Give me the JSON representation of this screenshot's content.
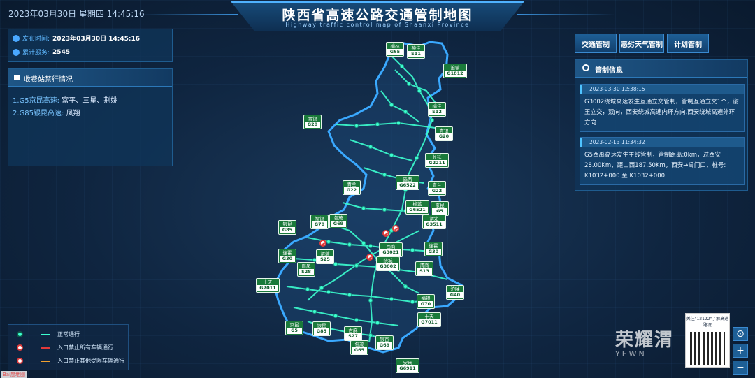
{
  "header": {
    "datetime": "2023年03月30日 星期四 14:45:16",
    "title": "陕西省高速公路交通管制地图",
    "subtitle": "Highway traffic control map of Shaanxi Province"
  },
  "info": {
    "publish_label": "发布时间:",
    "publish_value": "2023年03月30日 14:45:16",
    "service_label": "累计服务:",
    "service_value": "2545"
  },
  "toll": {
    "title": "收费站禁行情况",
    "items": [
      {
        "road": "1.G5京昆高速:",
        "stations": "富平、三星、荆姚"
      },
      {
        "road": "2.G85银昆高速:",
        "stations": "凤翔"
      }
    ]
  },
  "legend": {
    "items": [
      {
        "text": "正常通行",
        "color": "#3cffd0"
      },
      {
        "text": "入口禁止所有车辆通行",
        "color": "#e03a3a"
      },
      {
        "text": "入口禁止其他受限车辆通行",
        "color": "#f0a030"
      }
    ]
  },
  "tabs": [
    "交通管制",
    "恶劣天气管制",
    "计划管制"
  ],
  "control": {
    "title": "管制信息",
    "notices": [
      {
        "time": "2023-03-30 12:38:15",
        "text": "G3002绕城高速发生互通立交管制，管制互通立交1个，谢王立交，双向，西安绕城高速内环方向,西安绕城高速外环方向"
      },
      {
        "time": "2023-02-13 11:34:32",
        "text": "G5西禹高速发生主线管制，管制距离:0km，过西安28.00Km，距山西187.50Km，西安→禹门口，桩号: K1032+000 至 K1032+000"
      }
    ]
  },
  "signs": [
    {
      "name": "榆林",
      "code": "G65"
    },
    {
      "name": "神佳",
      "code": "S11"
    },
    {
      "name": "沧榆",
      "code": "G1812"
    },
    {
      "name": "榆佳",
      "code": "S12"
    },
    {
      "name": "青银",
      "code": "G20"
    },
    {
      "name": "青银",
      "code": "G20"
    },
    {
      "name": "长延",
      "code": "G2211"
    },
    {
      "name": "青兰",
      "code": "G22"
    },
    {
      "name": "延西",
      "code": "G6522"
    },
    {
      "name": "青兰",
      "code": "G22"
    },
    {
      "name": "榆蓝",
      "code": "G6521"
    },
    {
      "name": "京昆",
      "code": "G5"
    },
    {
      "name": "银昆",
      "code": "G85"
    },
    {
      "name": "福银",
      "code": "G70"
    },
    {
      "name": "包茂",
      "code": "G69"
    },
    {
      "name": "渭定",
      "code": "G3511"
    },
    {
      "name": "连霍",
      "code": "G30"
    },
    {
      "name": "渭蒲",
      "code": "S25"
    },
    {
      "name": "西商",
      "code": "G3021"
    },
    {
      "name": "连霍",
      "code": "G30"
    },
    {
      "name": "绕城",
      "code": "G3002"
    },
    {
      "name": "眉凤",
      "code": "S28"
    },
    {
      "name": "渭商",
      "code": "S13"
    },
    {
      "name": "十天",
      "code": "G7011"
    },
    {
      "name": "沪陕",
      "code": "G40"
    },
    {
      "name": "福银",
      "code": "G70"
    },
    {
      "name": "十天",
      "code": "G7011"
    },
    {
      "name": "京昆",
      "code": "G5"
    },
    {
      "name": "银昆",
      "code": "G85"
    },
    {
      "name": "古麻",
      "code": "S27"
    },
    {
      "name": "包茂",
      "code": "G65"
    },
    {
      "name": "银百",
      "code": "G69"
    },
    {
      "name": "安来",
      "code": "G6911"
    }
  ],
  "watermark": {
    "brand": "荣耀渭",
    "site": "YEWN"
  },
  "qr": {
    "label": "关注\"12122\"了解高速路况"
  },
  "zoom": {
    "in": "+",
    "out": "−"
  },
  "baidu": "Bai度地图"
}
